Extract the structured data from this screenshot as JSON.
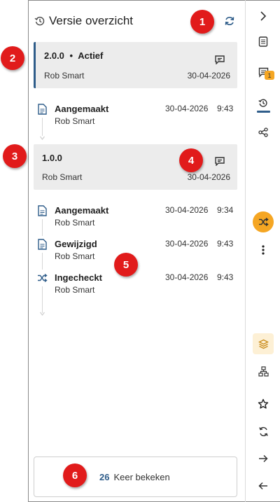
{
  "panel": {
    "title": "Versie overzicht"
  },
  "versions": [
    {
      "version": "2.0.0",
      "separator": "•",
      "status": "Actief",
      "user": "Rob Smart",
      "date": "30-04-2026"
    },
    {
      "version": "1.0.0",
      "user": "Rob Smart",
      "date": "30-04-2026"
    }
  ],
  "timeline_v2": [
    {
      "icon": "document-icon",
      "action": "Aangemaakt",
      "user": "Rob Smart",
      "date": "30-04-2026",
      "time": "9:43"
    }
  ],
  "timeline_v1": [
    {
      "icon": "document-icon",
      "action": "Aangemaakt",
      "user": "Rob Smart",
      "date": "30-04-2026",
      "time": "9:34"
    },
    {
      "icon": "document-icon",
      "action": "Gewijzigd",
      "user": "Rob Smart",
      "date": "30-04-2026",
      "time": "9:43"
    },
    {
      "icon": "shuffle-icon",
      "action": "Ingecheckt",
      "user": "Rob Smart",
      "date": "30-04-2026",
      "time": "9:43"
    }
  ],
  "views": {
    "count": "26",
    "label": "Keer bekeken"
  },
  "rail": {
    "badge_count": "1",
    "icons": [
      "chevron-right-icon",
      "document-icon",
      "comments-icon",
      "history-icon",
      "share-icon",
      "shuffle-icon",
      "more-icon",
      "layers-icon",
      "sitemap-icon",
      "star-icon",
      "sync-icon",
      "arrow-right-icon",
      "arrow-left-icon"
    ]
  },
  "callouts": [
    "1",
    "2",
    "3",
    "4",
    "5",
    "6"
  ],
  "colors": {
    "accent": "#2f5d8a",
    "orange": "#f5a623",
    "callout": "#e11b1b",
    "card_bg": "#ececec"
  }
}
